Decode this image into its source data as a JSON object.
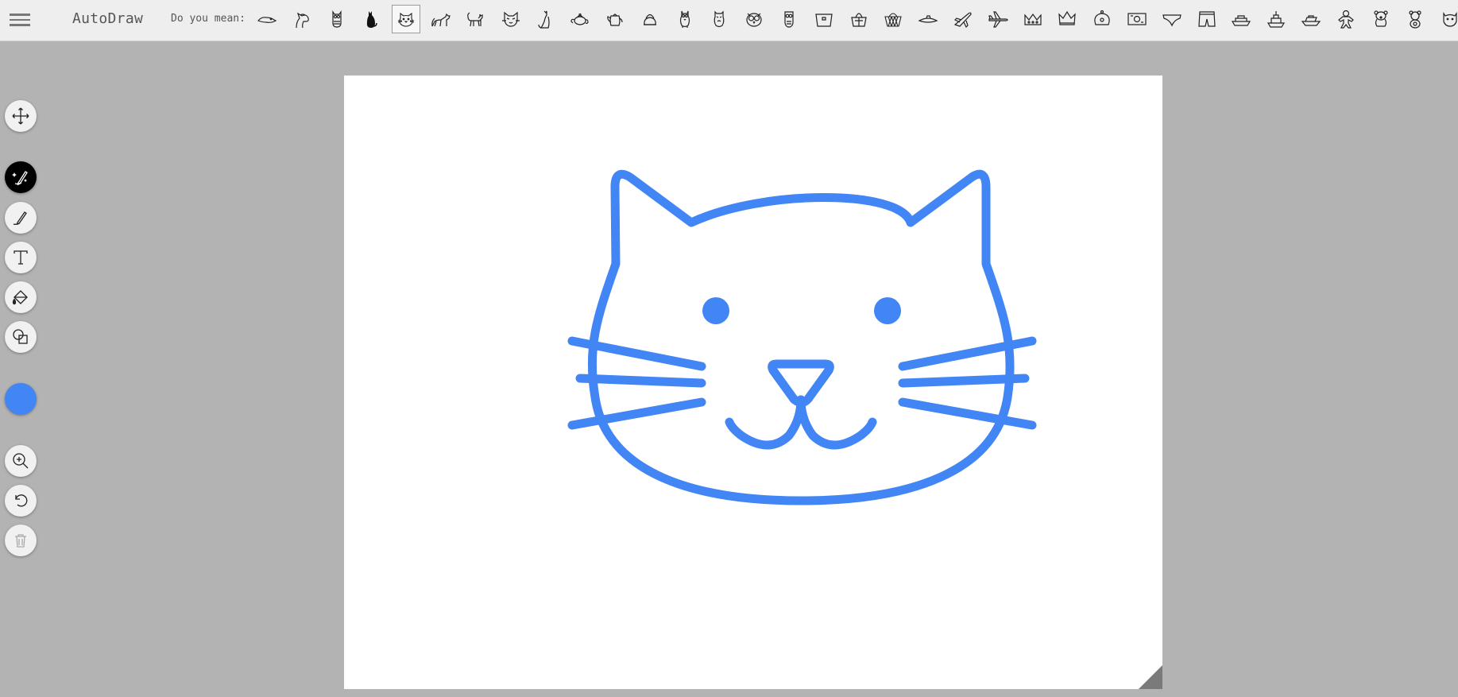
{
  "app": {
    "title": "AutoDraw",
    "suggest_label": "Do you mean:"
  },
  "suggestions": [
    {
      "icon": "platypus-icon"
    },
    {
      "icon": "horse-icon"
    },
    {
      "icon": "owl-icon"
    },
    {
      "icon": "black-cat-icon"
    },
    {
      "icon": "cat-face-icon",
      "selected": true
    },
    {
      "icon": "cat-stretching-icon"
    },
    {
      "icon": "cat-walking-icon"
    },
    {
      "icon": "cat-head-icon"
    },
    {
      "icon": "cat-sitting-icon"
    },
    {
      "icon": "teapot-icon"
    },
    {
      "icon": "teapot-tall-icon"
    },
    {
      "icon": "kettle-icon"
    },
    {
      "icon": "owl-standing-icon"
    },
    {
      "icon": "owl-outline-icon"
    },
    {
      "icon": "owl-face-icon"
    },
    {
      "icon": "owl-small-icon"
    },
    {
      "icon": "basket-icon"
    },
    {
      "icon": "shopping-basket-icon"
    },
    {
      "icon": "wicker-basket-icon"
    },
    {
      "icon": "submarine-icon"
    },
    {
      "icon": "jet-icon"
    },
    {
      "icon": "airplane-icon"
    },
    {
      "icon": "crown-icon"
    },
    {
      "icon": "crown-tall-icon"
    },
    {
      "icon": "crown-round-icon"
    },
    {
      "icon": "banknote-icon"
    },
    {
      "icon": "briefs-icon"
    },
    {
      "icon": "shorts-icon"
    },
    {
      "icon": "ship-icon"
    },
    {
      "icon": "cruise-ship-icon"
    },
    {
      "icon": "boat-icon"
    },
    {
      "icon": "gingerbread-icon"
    },
    {
      "icon": "bear-icon"
    },
    {
      "icon": "teddy-bear-icon"
    },
    {
      "icon": "face-icon"
    }
  ],
  "tools": [
    {
      "name": "move-tool",
      "icon": "move-icon"
    },
    {
      "name": "autodraw-tool",
      "icon": "autodraw-icon",
      "active": true
    },
    {
      "name": "draw-tool",
      "icon": "pencil-icon"
    },
    {
      "name": "type-tool",
      "icon": "text-icon"
    },
    {
      "name": "fill-tool",
      "icon": "paint-bucket-icon"
    },
    {
      "name": "shape-tool",
      "icon": "shapes-icon"
    },
    {
      "name": "zoom-tool",
      "icon": "zoom-in-icon"
    },
    {
      "name": "undo-tool",
      "icon": "undo-icon"
    },
    {
      "name": "delete-tool",
      "icon": "trash-icon",
      "disabled": true
    }
  ],
  "colors": {
    "selected_color": "#4285f4",
    "drawing_stroke": "#4285f4",
    "topbar_bg": "#eeeeee",
    "workspace_bg": "#b3b3b3",
    "canvas_bg": "#ffffff"
  }
}
